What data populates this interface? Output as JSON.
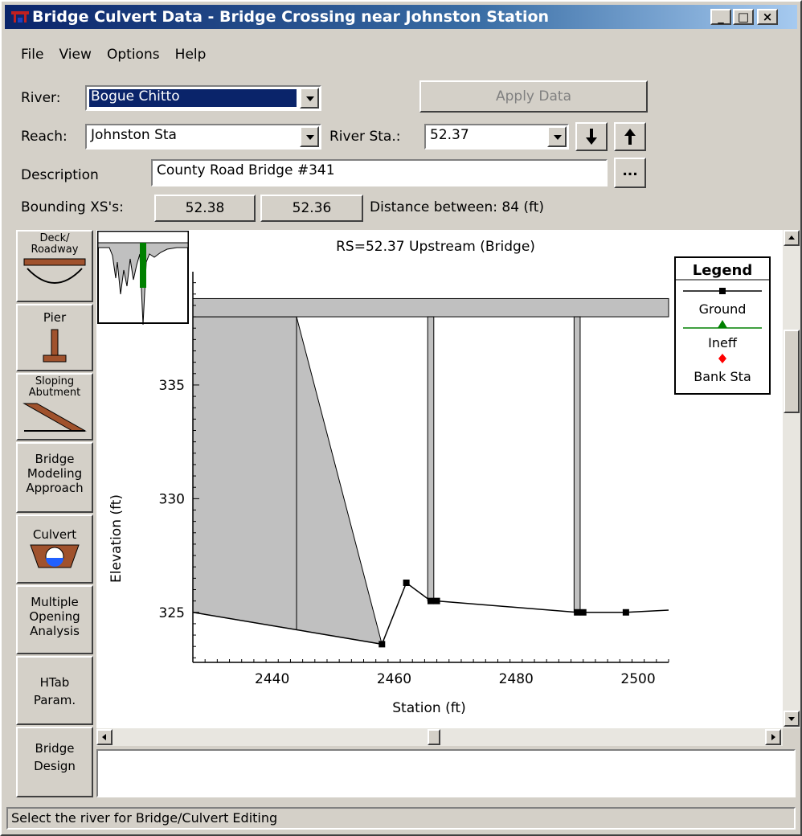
{
  "window": {
    "title": "Bridge Culvert Data - Bridge Crossing near Johnston Station",
    "minimize": "_",
    "maximize": "□",
    "close": "×"
  },
  "menu": [
    "File",
    "View",
    "Options",
    "Help"
  ],
  "form": {
    "river_label": "River:",
    "river_value": "Bogue Chitto",
    "apply_button": "Apply Data",
    "reach_label": "Reach:",
    "reach_value": "Johnston Sta",
    "river_sta_label": "River Sta.:",
    "river_sta_value": "52.37",
    "description_label": "Description",
    "description_value": "County Road Bridge #341",
    "description_more": "...",
    "bounding_label": "Bounding XS's:",
    "bounding_up": "52.38",
    "bounding_down": "52.36",
    "distance_text": "Distance between: 84 (ft)"
  },
  "side_buttons": [
    {
      "label": "Deck/\nRoadway",
      "icon": "deck-roadway-icon"
    },
    {
      "label": "Pier",
      "icon": "pier-icon"
    },
    {
      "label": "Sloping\nAbutment",
      "icon": "sloping-abutment-icon"
    },
    {
      "label": "Bridge\nModeling\nApproach",
      "icon": ""
    },
    {
      "label": "Culvert",
      "icon": "culvert-icon"
    },
    {
      "label": "Multiple\nOpening\nAnalysis",
      "icon": ""
    },
    {
      "label": "HTab\nParam.",
      "icon": ""
    },
    {
      "label": "Bridge\nDesign",
      "icon": ""
    }
  ],
  "chart_data": {
    "type": "line",
    "title": "RS=52.37   Upstream  (Bridge)",
    "xlabel": "Station (ft)",
    "ylabel": "Elevation (ft)",
    "xlim": [
      2427,
      2505
    ],
    "ylim": [
      322.8,
      339.7
    ],
    "xticks": [
      2440,
      2460,
      2480,
      2500
    ],
    "yticks": [
      325,
      330,
      335
    ],
    "ground": {
      "x": [
        2427,
        2458,
        2462,
        2466,
        2467,
        2490,
        2491,
        2498,
        2505
      ],
      "y": [
        325.0,
        323.6,
        326.3,
        325.5,
        325.5,
        325.0,
        325.0,
        325.0,
        325.1
      ]
    },
    "ground_markers_x": [
      2458,
      2462,
      2466,
      2467,
      2490,
      2491,
      2498
    ],
    "deck": {
      "x_start": 2427,
      "x_end": 2505,
      "high_chord": 338.8,
      "low_chord": 338.0
    },
    "left_abutment_x": 2444,
    "piers": [
      {
        "x": 2466,
        "width": 1
      },
      {
        "x": 2490,
        "width": 1
      }
    ],
    "legend": {
      "title": "Legend",
      "items": [
        {
          "name": "Ground",
          "color": "#000000",
          "marker": "square"
        },
        {
          "name": "Ineff",
          "color": "#008000",
          "marker": "triangle"
        },
        {
          "name": "Bank Sta",
          "color": "#ff0000",
          "marker": "diamond"
        }
      ]
    },
    "fill_color": "#c0c0c0"
  },
  "status": "Select the river for Bridge/Culvert Editing"
}
